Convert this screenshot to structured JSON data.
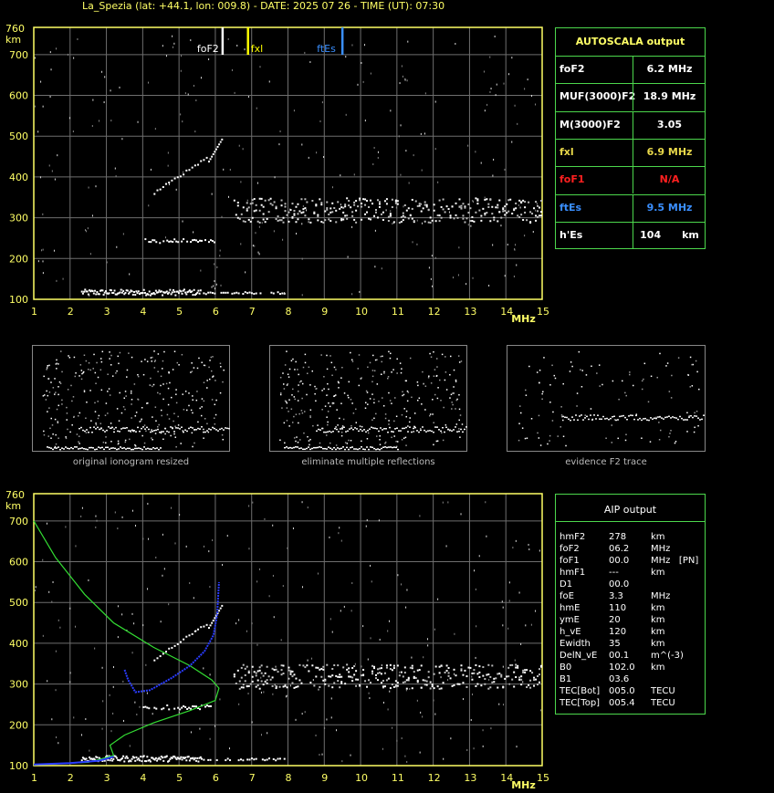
{
  "header": {
    "title": "La_Spezia (lat: +44.1, lon: 009.8) - DATE: 2025 07 26 - TIME (UT): 07:30"
  },
  "ionogram": {
    "y_unit": "km",
    "x_unit": "MHz",
    "y_top_label": "760",
    "y_ticks": [
      "700",
      "600",
      "500",
      "400",
      "300",
      "200",
      "100"
    ],
    "x_ticks": [
      "1",
      "2",
      "3",
      "4",
      "5",
      "6",
      "7",
      "8",
      "9",
      "10",
      "11",
      "12",
      "13",
      "14",
      "15"
    ],
    "markers": [
      {
        "label": "foF2",
        "value": 6.2,
        "color": "#ffffff"
      },
      {
        "label": "fxl",
        "value": 6.9,
        "color": "#ffff00"
      },
      {
        "label": "ftEs",
        "value": 9.5,
        "color": "#3a8fff"
      }
    ]
  },
  "autoscala": {
    "title": "AUTOSCALA output",
    "rows": [
      {
        "key": "foF2",
        "value": "6.2 MHz",
        "color": "#ffffff"
      },
      {
        "key": "MUF(3000)F2",
        "value": "18.9 MHz",
        "color": "#ffffff"
      },
      {
        "key": "M(3000)F2",
        "value": "3.05",
        "color": "#ffffff"
      },
      {
        "key": "fxl",
        "value": "6.9 MHz",
        "color": "#e8d84a"
      },
      {
        "key": "foF1",
        "value": "N/A",
        "color": "#ff2020"
      },
      {
        "key": "ftEs",
        "value": "9.5 MHz",
        "color": "#3a8fff"
      },
      {
        "key": "h'Es",
        "value": "104",
        "unit": "km",
        "color": "#ffffff"
      }
    ]
  },
  "thumbnails": {
    "captions": [
      "original ionogram resized",
      "eliminate multiple reflections",
      "evidence F2 trace"
    ]
  },
  "aip": {
    "title": "AIP output",
    "rows": [
      {
        "k": "hmF2",
        "v": "278",
        "u": "km"
      },
      {
        "k": "foF2",
        "v": "06.2",
        "u": "MHz"
      },
      {
        "k": "foF1",
        "v": "00.0",
        "u": "MHz   [PN]"
      },
      {
        "k": "hmF1",
        "v": "---",
        "u": "km"
      },
      {
        "k": "D1",
        "v": "00.0",
        "u": ""
      },
      {
        "k": "foE",
        "v": "3.3",
        "u": "MHz"
      },
      {
        "k": "hmE",
        "v": "110",
        "u": "km"
      },
      {
        "k": "ymE",
        "v": "20",
        "u": "km"
      },
      {
        "k": "h_vE",
        "v": "120",
        "u": "km"
      },
      {
        "k": "Ewidth",
        "v": "35",
        "u": "km"
      },
      {
        "k": "DelN_vE",
        "v": "00.1",
        "u": "m^(-3)"
      },
      {
        "k": "B0",
        "v": "102.0",
        "u": "km"
      },
      {
        "k": "B1",
        "v": "03.6",
        "u": ""
      },
      {
        "k": "TEC[Bot]",
        "v": "005.0",
        "u": "TECU"
      },
      {
        "k": "TEC[Top]",
        "v": "005.4",
        "u": "TECU"
      }
    ]
  },
  "colors": {
    "grid": "#6e6e6e",
    "frame": "#ffff66",
    "table_border": "#4cd74c",
    "profile": "#33dd33",
    "trace": "#2a3cff"
  }
}
